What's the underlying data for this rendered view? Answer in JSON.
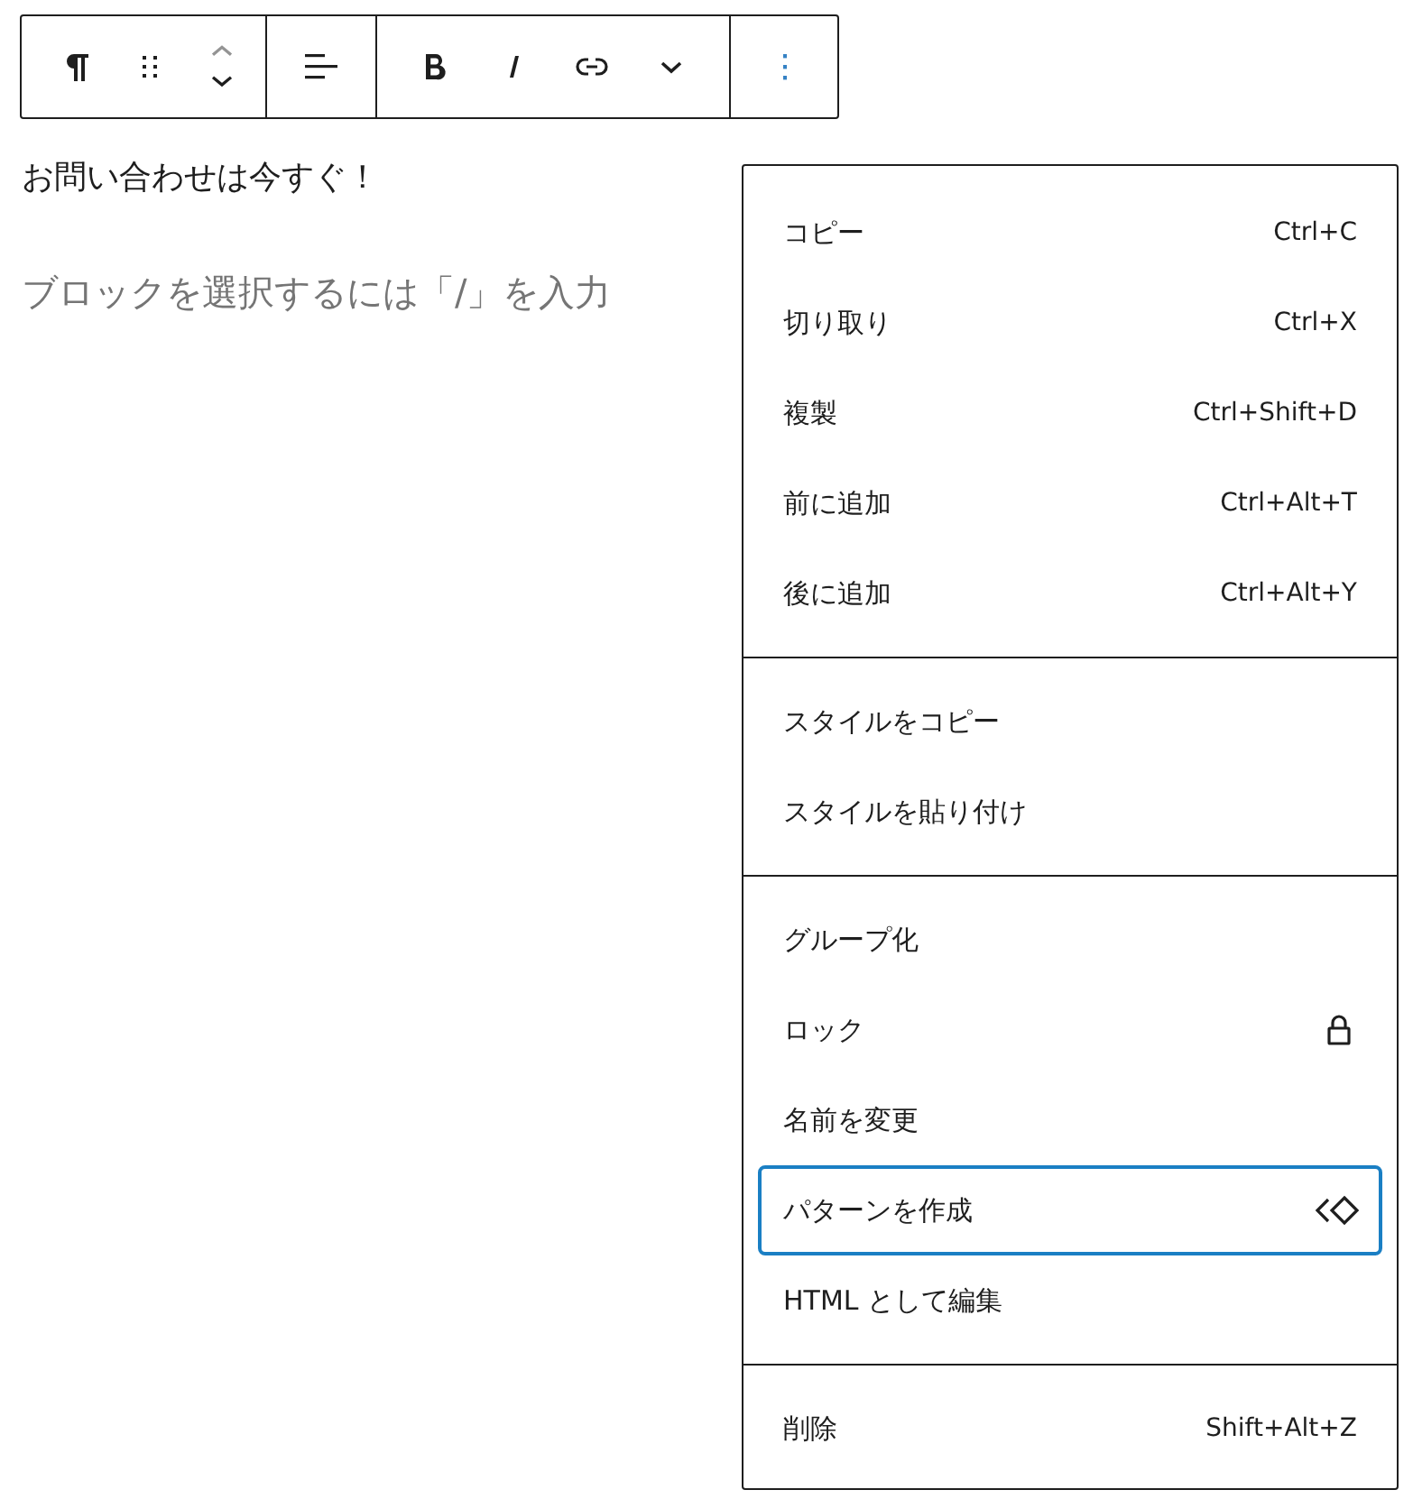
{
  "toolbar": {
    "groups": [
      {
        "buttons": [
          {
            "kind": "paragraph"
          },
          {
            "kind": "drag"
          },
          {
            "kind": "move"
          }
        ]
      },
      {
        "buttons": [
          {
            "kind": "align"
          }
        ]
      },
      {
        "buttons": [
          {
            "kind": "bold"
          },
          {
            "kind": "italic"
          },
          {
            "kind": "link"
          },
          {
            "kind": "more"
          }
        ]
      },
      {
        "buttons": [
          {
            "kind": "options"
          }
        ]
      }
    ]
  },
  "content": {
    "paragraph": "お問い合わせは今すぐ！",
    "placeholder": "ブロックを選択するには「/」を入力"
  },
  "menu": {
    "sections": [
      {
        "items": [
          {
            "label": "コピー",
            "kind": "shortcut",
            "shortcut": "Ctrl+C",
            "selected": false
          },
          {
            "label": "切り取り",
            "kind": "shortcut",
            "shortcut": "Ctrl+X",
            "selected": false
          },
          {
            "label": "複製",
            "kind": "shortcut",
            "shortcut": "Ctrl+Shift+D",
            "selected": false
          },
          {
            "label": "前に追加",
            "kind": "shortcut",
            "shortcut": "Ctrl+Alt+T",
            "selected": false
          },
          {
            "label": "後に追加",
            "kind": "shortcut",
            "shortcut": "Ctrl+Alt+Y",
            "selected": false
          }
        ]
      },
      {
        "items": [
          {
            "label": "スタイルをコピー",
            "kind": "plain",
            "selected": false
          },
          {
            "label": "スタイルを貼り付け",
            "kind": "plain",
            "selected": false
          }
        ]
      },
      {
        "items": [
          {
            "label": "グループ化",
            "kind": "plain",
            "selected": false
          },
          {
            "label": "ロック",
            "kind": "lock",
            "selected": false
          },
          {
            "label": "名前を変更",
            "kind": "plain",
            "selected": false
          },
          {
            "label": "パターンを作成",
            "kind": "pattern",
            "selected": true
          },
          {
            "label": "HTML として編集",
            "kind": "plain",
            "selected": false
          }
        ]
      },
      {
        "items": [
          {
            "label": "削除",
            "kind": "shortcut",
            "shortcut": "Shift+Alt+Z",
            "selected": false
          }
        ]
      }
    ]
  }
}
